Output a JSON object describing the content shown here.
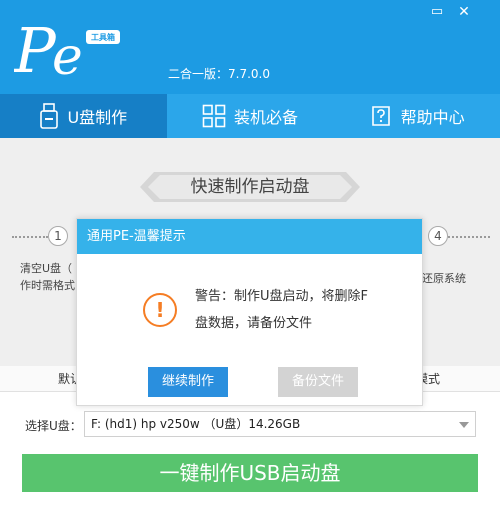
{
  "header": {
    "logo_text": "工具箱",
    "version": "二合一版：7.7.0.0",
    "minimize": "▭",
    "close": "✕"
  },
  "tabs": [
    {
      "label": "U盘制作",
      "icon": "usb-drive-icon"
    },
    {
      "label": "装机必备",
      "icon": "grid-apps-icon"
    },
    {
      "label": "帮助中心",
      "icon": "help-book-icon"
    }
  ],
  "main": {
    "banner": "快速制作启动盘",
    "steps": [
      {
        "num": "1",
        "desc_lines": [
          "清空U盘（",
          "作时需格式"
        ]
      },
      {
        "num": "4",
        "desc_lines": [
          "还原系统"
        ]
      }
    ]
  },
  "modal": {
    "title": "通用PE-温馨提示",
    "icon": "!",
    "message_lines": [
      "警告：制作U盘启动，将删除F",
      "盘数据，请备份文件"
    ],
    "continue_label": "继续制作",
    "backup_label": "备份文件"
  },
  "bottom": {
    "tab_left": "默认",
    "tab_right": "模式",
    "usb_label": "选择U盘：",
    "usb_value": "F: (hd1) hp v250w （U盘）14.26GB",
    "make_button": "一键制作USB启动盘"
  },
  "colors": {
    "header_blue": "#1d9be3",
    "active_tab": "#167fc6",
    "modal_title": "#35b2ea",
    "warning": "#f57d24",
    "green_button": "#58c46e",
    "blue_button": "#2a8fde"
  }
}
